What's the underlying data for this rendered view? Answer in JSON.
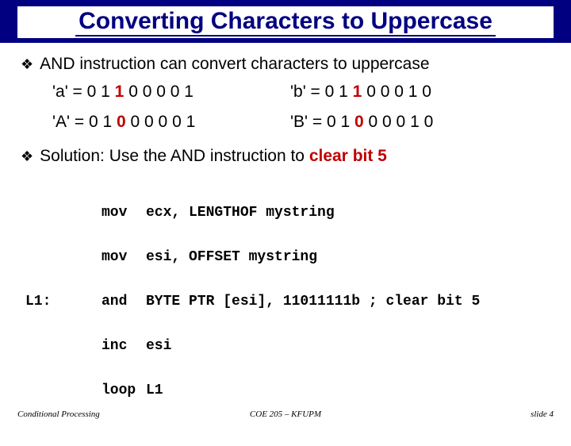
{
  "title": "Converting Characters to Uppercase",
  "bullet1": "AND instruction can convert characters to uppercase",
  "binary": {
    "a_label": "'a' = ",
    "a_pre": "0 1 ",
    "a_bit": "1",
    "a_post": " 0 0 0 0 1",
    "b_label": "'b' = ",
    "b_pre": "0 1 ",
    "b_bit": "1",
    "b_post": " 0 0 0 1 0",
    "A_label": "'A' = ",
    "A_pre": "0 1 ",
    "A_bit": "0",
    "A_post": " 0 0 0 0 1",
    "B_label": "'B' = ",
    "B_pre": "0 1 ",
    "B_bit": "0",
    "B_post": " 0 0 0 1 0"
  },
  "bullet2_pre": "Solution: Use the AND instruction to ",
  "bullet2_hl": "clear bit 5",
  "code": {
    "l1_label": "L1:",
    "line1_op": "mov",
    "line1_args": "ecx, LENGTHOF mystring",
    "line2_op": "mov",
    "line2_args": "esi, OFFSET mystring",
    "line3_op": "and",
    "line3_args": "BYTE PTR [esi], 11011111b ; clear bit 5",
    "line4_op": "inc",
    "line4_args": "esi",
    "line5_op": "loop",
    "line5_args": "L1"
  },
  "footer": {
    "left": "Conditional Processing",
    "center": "COE 205 – KFUPM",
    "right": "slide 4"
  }
}
